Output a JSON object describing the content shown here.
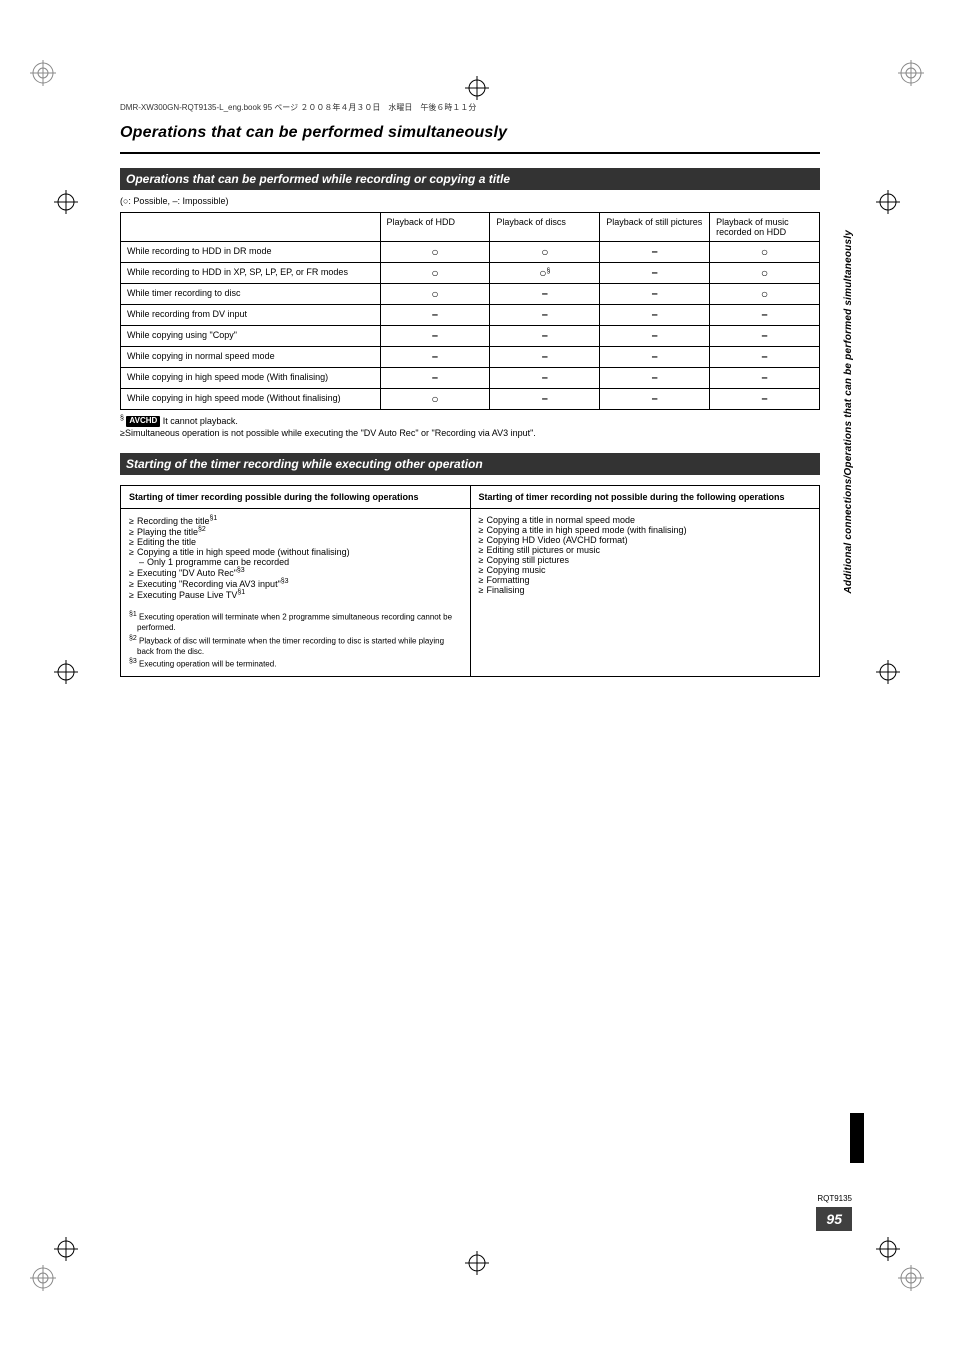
{
  "header_line": "DMR-XW300GN-RQT9135-L_eng.book  95 ページ  ２００８年４月３０日　水曜日　午後６時１１分",
  "main_title": "Operations that can be performed simultaneously",
  "section1_title": "Operations that can be performed while recording or copying a title",
  "legend": "(○: Possible, –: Impossible)",
  "table1": {
    "headers": [
      "",
      "Playback of HDD",
      "Playback of discs",
      "Playback of still pictures",
      "Playback of music recorded on HDD"
    ],
    "rows": [
      {
        "label": "While recording to HDD in DR mode",
        "cells": [
          "○",
          "○",
          "–",
          "○"
        ]
      },
      {
        "label": "While recording to HDD in XP, SP, LP, EP, or FR modes",
        "cells": [
          "○",
          "○§",
          "–",
          "○"
        ]
      },
      {
        "label": "While timer recording to disc",
        "cells": [
          "○",
          "–",
          "–",
          "○"
        ]
      },
      {
        "label": "While recording from DV input",
        "cells": [
          "–",
          "–",
          "–",
          "–"
        ]
      },
      {
        "label": "While copying using \"Copy\"",
        "cells": [
          "–",
          "–",
          "–",
          "–"
        ]
      },
      {
        "label": "While copying in normal speed mode",
        "cells": [
          "–",
          "–",
          "–",
          "–"
        ]
      },
      {
        "label": "While copying in high speed mode (With finalising)",
        "cells": [
          "–",
          "–",
          "–",
          "–"
        ]
      },
      {
        "label": "While copying in high speed mode (Without finalising)",
        "cells": [
          "○",
          "–",
          "–",
          "–"
        ]
      }
    ]
  },
  "note_sym": "§",
  "note_chip": "AVCHD",
  "note1_text": " It cannot playback.",
  "note2_text": "Simultaneous operation is not possible while executing the \"DV Auto Rec\" or \"Recording via AV3 input\".",
  "section2_title": "Starting of the timer recording while executing other operation",
  "table2": {
    "left_header": "Starting of timer recording possible during the following operations",
    "right_header": "Starting of timer recording not possible during the following operations",
    "left_items": [
      "Recording the title§1",
      "Playing the title§2",
      "Editing the title",
      "Copying a title in high speed mode (without finalising)",
      "Only 1 programme can be recorded",
      "Executing \"DV Auto Rec\"§3",
      "Executing \"Recording via AV3 input\"§3",
      "Executing Pause Live TV§1"
    ],
    "left_footnotes": [
      "§1 Executing operation will terminate when 2 programme simultaneous recording cannot be performed.",
      "§2 Playback of disc will terminate when the timer recording to disc is started while playing back from the disc.",
      "§3 Executing operation will be terminated."
    ],
    "right_items": [
      "Copying a title in normal speed mode",
      "Copying a title in high speed mode (with finalising)",
      "Copying HD Video (AVCHD format)",
      "Editing still pictures or music",
      "Copying still pictures",
      "Copying music",
      "Formatting",
      "Finalising"
    ]
  },
  "side_text": "Additional connections/Operations that can be performed simultaneously",
  "doc_code": "RQT9135",
  "page_number": "95"
}
